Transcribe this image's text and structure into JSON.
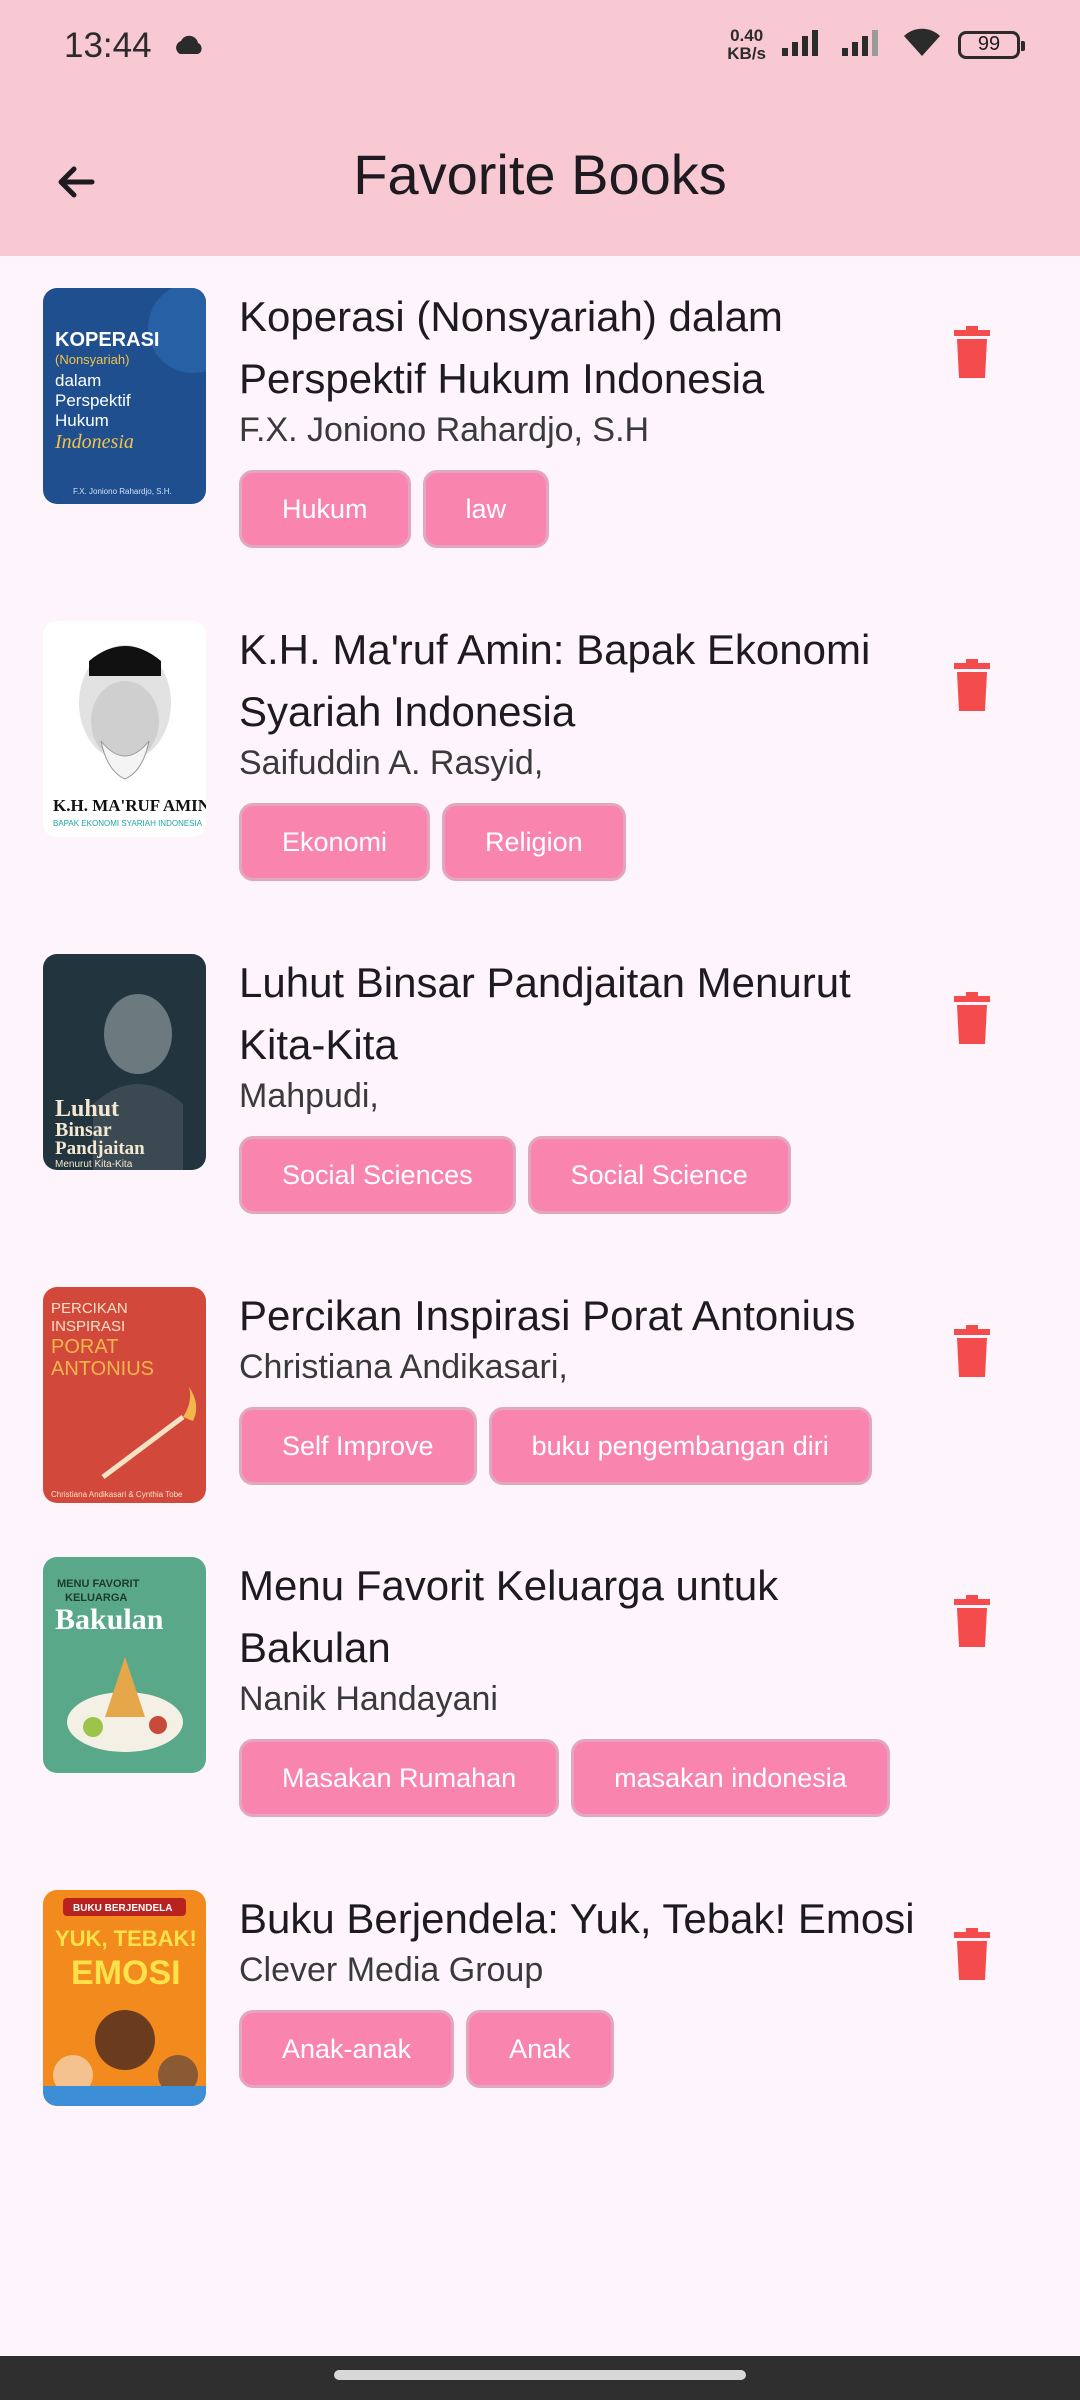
{
  "status_bar": {
    "time": "13:44",
    "net_speed_value": "0.40",
    "net_speed_unit": "KB/s",
    "battery": "99"
  },
  "header": {
    "title": "Favorite Books"
  },
  "books": [
    {
      "title": "Koperasi (Nonsyariah) dalam Perspektif Hukum Indonesia",
      "author": "F.X. Joniono Rahardjo, S.H",
      "tags": [
        "Hukum",
        "law"
      ],
      "cover": {
        "lines": [
          "KOPERASI",
          "(Nonsyariah)",
          "dalam",
          "Perspektif",
          "Hukum",
          "Indonesia"
        ],
        "byline": "F.X. Joniono Rahardjo, S.H.",
        "bg": "#1f4f8f"
      }
    },
    {
      "title": "K.H. Ma'ruf Amin: Bapak Ekonomi Syariah Indonesia",
      "author": "Saifuddin A. Rasyid,",
      "tags": [
        "Ekonomi",
        "Religion"
      ],
      "cover": {
        "lines": [
          "K.H. MA'RUF AMIN",
          "BAPAK EKONOMI SYARIAH INDONESIA"
        ],
        "bg": "#ffffff"
      }
    },
    {
      "title": "Luhut Binsar Pandjaitan Menurut Kita-Kita",
      "author": "Mahpudi,",
      "tags": [
        "Social Sciences",
        "Social Science"
      ],
      "cover": {
        "lines": [
          "Luhut",
          "Binsar",
          "Pandjaitan",
          "Menurut Kita-Kita"
        ],
        "bg": "#22343d"
      }
    },
    {
      "title": "Percikan Inspirasi Porat Antonius",
      "author": "Christiana Andikasari,",
      "tags": [
        "Self Improve",
        "buku pengembangan diri"
      ],
      "cover": {
        "lines": [
          "PERCIKAN",
          "INSPIRASI",
          "PORAT",
          "ANTONIUS",
          "Christiana Andikasari & Cynthia Tobe"
        ],
        "bg": "#d2493c"
      }
    },
    {
      "title": "Menu Favorit Keluarga untuk Bakulan",
      "author": "Nanik Handayani",
      "tags": [
        "Masakan Rumahan",
        "masakan indonesia"
      ],
      "cover": {
        "lines": [
          "MENU FAVORIT",
          "KELUARGA",
          "Bakulan"
        ],
        "bg": "#5aa88a"
      }
    },
    {
      "title": "Buku Berjendela: Yuk, Tebak! Emosi",
      "author": "Clever Media Group",
      "tags": [
        "Anak-anak",
        "Anak"
      ],
      "cover": {
        "lines": [
          "BUKU BERJENDELA",
          "YUK, TEBAK!",
          "EMOSI"
        ],
        "bg": "#f28a1e"
      }
    }
  ]
}
